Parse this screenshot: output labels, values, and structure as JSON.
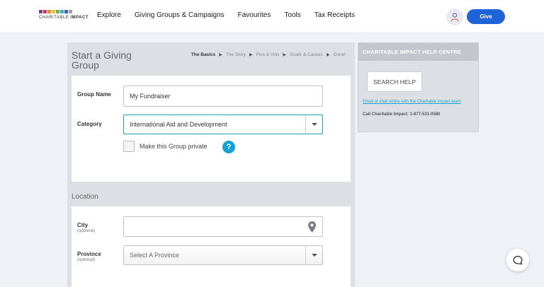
{
  "brand": {
    "logo_text_a": "CHARITABLE",
    "logo_text_b": "IMPACT",
    "logo_colors": [
      "#7b3f8c",
      "#c83f5c",
      "#e08a3c",
      "#e9c23a",
      "#6bb34a",
      "#3fa9c9",
      "#3c63b4",
      "#9aa0a8"
    ]
  },
  "nav": {
    "items": [
      "Explore",
      "Giving Groups & Campaigns",
      "Favourites",
      "Tools",
      "Tax Receipts"
    ],
    "give_label": "Give"
  },
  "form": {
    "title": "Start a Giving Group",
    "steps": [
      "The Basics",
      "The Story",
      "Pics & Vids",
      "Goals & Causes",
      "Done!"
    ],
    "active_step": "The Basics",
    "group_name_label": "Group Name",
    "group_name_value": "My Fundraiser",
    "category_label": "Category",
    "category_value": "International Aid and Development",
    "private_label": "Make this Group private",
    "help_symbol": "?",
    "location_title": "Location",
    "city_label": "City",
    "city_sub": "(optional)",
    "city_value": "",
    "province_label": "Province",
    "province_sub": "(optional)",
    "province_value": "Select A Province"
  },
  "help": {
    "title": "CHARITABLE IMPACT HELP CENTRE",
    "search_label": "SEARCH HELP",
    "link_text": "Email or chat online with the Charitable Impact team",
    "phone_text": "Call Charitable Impact: 1-877-531-0580"
  },
  "colors": {
    "accent": "#1f63d9",
    "teal": "#1fa3b7",
    "help_icon": "#17a2d4"
  }
}
